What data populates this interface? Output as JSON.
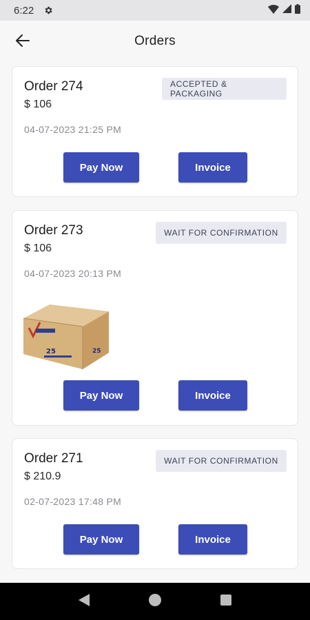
{
  "status_bar": {
    "time": "6:22"
  },
  "header": {
    "title": "Orders"
  },
  "orders": [
    {
      "title": "Order 274",
      "price": "$ 106",
      "date": "04-07-2023 21:25 PM",
      "status": "ACCEPTED & PACKAGING",
      "pay_label": "Pay Now",
      "invoice_label": "Invoice"
    },
    {
      "title": "Order 273",
      "price": "$ 106",
      "date": "04-07-2023 20:13 PM",
      "status": "WAIT FOR CONFIRMATION",
      "pay_label": "Pay Now",
      "invoice_label": "Invoice"
    },
    {
      "title": "Order 271",
      "price": "$ 210.9",
      "date": "02-07-2023 17:48 PM",
      "status": "WAIT FOR CONFIRMATION",
      "pay_label": "Pay Now",
      "invoice_label": "Invoice"
    }
  ],
  "colors": {
    "accent": "#3d4db7",
    "badge_bg": "#e9eaf1",
    "page_bg": "#f7f7f8"
  },
  "icons": [
    "gear-icon",
    "wifi-icon",
    "signal-icon",
    "battery-icon",
    "back-arrow-icon",
    "nav-back-icon",
    "nav-home-icon",
    "nav-recents-icon"
  ]
}
